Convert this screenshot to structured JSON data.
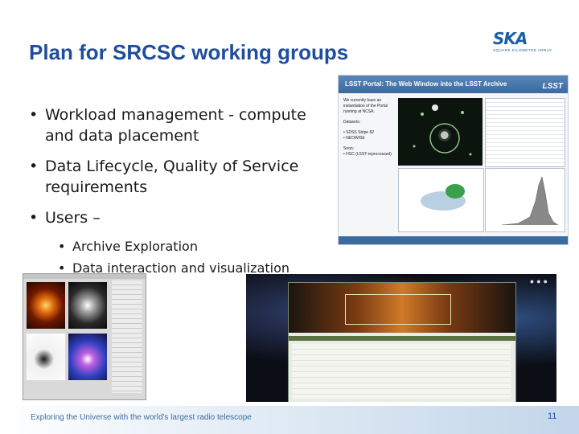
{
  "slide": {
    "title": "Plan for SRCSC working groups",
    "logo": {
      "text": "SKA",
      "subtext": "SQUARE KILOMETRE ARRAY"
    },
    "bullets": [
      {
        "text": "Workload management  - compute and data placement"
      },
      {
        "text": "Data Lifecycle, Quality of Service requirements"
      },
      {
        "text": "Users –",
        "children": [
          "Archive Exploration",
          "Data interaction and visualization"
        ]
      }
    ],
    "lsst_panel": {
      "header": "LSST Portal: The Web Window into the LSST Archive",
      "logo": "LSST",
      "side_text": [
        "We currently have an instantiation of the Portal running at NCSA.",
        "Datasets:",
        "• SDSS Stripe 82",
        "• NEOWISE",
        "Soon:",
        "• HSC (LSST-reprocessed)"
      ]
    },
    "footer": {
      "text": "Exploring the Universe with the world's largest radio telescope",
      "page_number": "11"
    }
  }
}
